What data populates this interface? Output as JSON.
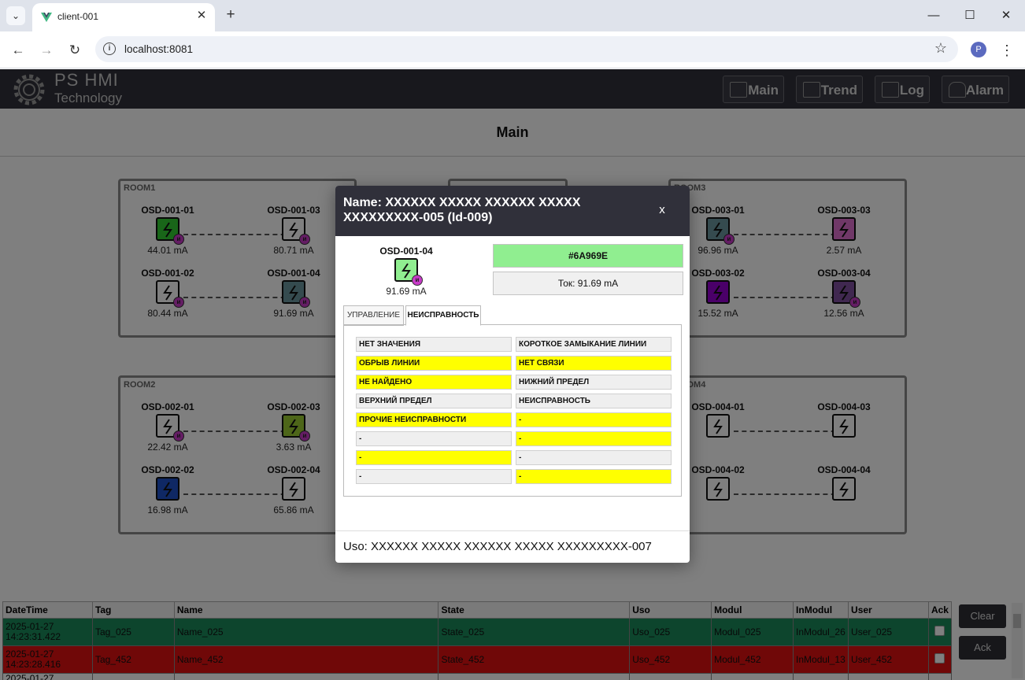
{
  "browser": {
    "tab_title": "client-001",
    "url": "localhost:8081",
    "profile_initial": "P",
    "icons": [
      "chevron-down-icon",
      "vue-logo-icon",
      "close-icon",
      "plus-icon",
      "minimize-icon",
      "maximize-icon",
      "back-icon",
      "forward-icon",
      "reload-icon",
      "info-icon",
      "star-icon",
      "kebab-menu-icon"
    ]
  },
  "app": {
    "logo_line1": "PS HMI",
    "logo_line2": "Technology",
    "nav": [
      {
        "label": "Main",
        "icon": "dashboard-icon"
      },
      {
        "label": "Trend",
        "icon": "chart-icon"
      },
      {
        "label": "Log",
        "icon": "log-icon"
      },
      {
        "label": "Alarm",
        "icon": "bell-icon"
      }
    ],
    "page_title": "Main"
  },
  "rooms": [
    {
      "label": "ROOM1",
      "devices": [
        {
          "name": "OSD-001-01",
          "value": "44.01 mA",
          "color": "#32CD32",
          "badge": true
        },
        {
          "name": "OSD-001-03",
          "value": "80.71 mA",
          "color": "#FFFFFF",
          "badge": true
        },
        {
          "name": "OSD-001-02",
          "value": "80.44 mA",
          "color": "#FFFFFF",
          "badge": true
        },
        {
          "name": "OSD-001-04",
          "value": "91.69 mA",
          "color": "#6A969E",
          "badge": true
        }
      ]
    },
    {
      "label": "ROOM2",
      "devices": [
        {
          "name": "OSD-002-01",
          "value": "22.42 mA",
          "color": "#FFFFFF",
          "badge": true
        },
        {
          "name": "OSD-002-03",
          "value": "3.63 mA",
          "color": "#9ACD32",
          "badge": true
        },
        {
          "name": "OSD-002-02",
          "value": "16.98 mA",
          "color": "#1E50C8",
          "badge": false
        },
        {
          "name": "OSD-002-04",
          "value": "65.86 mA",
          "color": "#FFFFFF",
          "badge": false
        }
      ]
    },
    {
      "label": "ROOM3",
      "devices": [
        {
          "name": "OSD-003-01",
          "value": "96.96 mA",
          "color": "#6A969E",
          "badge": true
        },
        {
          "name": "OSD-003-03",
          "value": "2.57 mA",
          "color": "#E070D0",
          "badge": false
        },
        {
          "name": "OSD-003-02",
          "value": "15.52 mA",
          "color": "#9400D3",
          "badge": false
        },
        {
          "name": "OSD-003-04",
          "value": "12.56 mA",
          "color": "#8050A0",
          "badge": true
        }
      ]
    },
    {
      "label": "ROOM4",
      "devices": [
        {
          "name": "OSD-004-01",
          "value": "",
          "color": "#FFFFFF",
          "badge": false
        },
        {
          "name": "OSD-004-03",
          "value": "",
          "color": "#FFFFFF",
          "badge": false
        },
        {
          "name": "OSD-004-02",
          "value": "",
          "color": "#FFFFFF",
          "badge": false
        },
        {
          "name": "OSD-004-04",
          "value": "",
          "color": "#FFFFFF",
          "badge": false
        }
      ]
    }
  ],
  "modal": {
    "title": "Name: XXXXXX XXXXX XXXXXX XXXXX XXXXXXXXX-005 (Id-009)",
    "close_label": "x",
    "device_name": "OSD-001-04",
    "device_value": "91.69 mA",
    "color_hex": "#6A969E",
    "current_text": "Ток: 91.69 mA",
    "tabs": [
      "УПРАВЛЕНИЕ",
      "НЕИСПРАВНОСТЬ"
    ],
    "active_tab": "НЕИСПРАВНОСТЬ",
    "faults": [
      {
        "label": "НЕТ ЗНАЧЕНИЯ",
        "active": false
      },
      {
        "label": "КОРОТКОЕ ЗАМЫКАНИЕ ЛИНИИ",
        "active": false
      },
      {
        "label": "ОБРЫВ ЛИНИИ",
        "active": true
      },
      {
        "label": "НЕТ СВЯЗИ",
        "active": true
      },
      {
        "label": "НЕ НАЙДЕНО",
        "active": true
      },
      {
        "label": "НИЖНИЙ ПРЕДЕЛ",
        "active": false
      },
      {
        "label": "ВЕРХНИЙ ПРЕДЕЛ",
        "active": false
      },
      {
        "label": "НЕИСПРАВНОСТЬ",
        "active": false
      },
      {
        "label": "ПРОЧИЕ НЕИСПРАВНОСТИ",
        "active": true
      },
      {
        "label": "-",
        "active": true
      },
      {
        "label": "-",
        "active": false
      },
      {
        "label": "-",
        "active": true
      },
      {
        "label": "-",
        "active": true
      },
      {
        "label": "-",
        "active": false
      },
      {
        "label": "-",
        "active": false
      },
      {
        "label": "-",
        "active": true
      }
    ],
    "footer": "Uso: XXXXXX XXXXX XXXXXX XXXXX XXXXXXXXX-007"
  },
  "alarms": {
    "columns": [
      "DateTime",
      "Tag",
      "Name",
      "State",
      "Uso",
      "Modul",
      "InModul",
      "User",
      "Ack"
    ],
    "rows": [
      {
        "date": "2025-01-27",
        "time": "14:23:31.422",
        "tag": "Tag_025",
        "name": "Name_025",
        "state": "State_025",
        "uso": "Uso_025",
        "modul": "Modul_025",
        "inmodul": "InModul_26",
        "user": "User_025"
      },
      {
        "date": "2025-01-27",
        "time": "14:23:28.416",
        "tag": "Tag_452",
        "name": "Name_452",
        "state": "State_452",
        "uso": "Uso_452",
        "modul": "Modul_452",
        "inmodul": "InModul_13",
        "user": "User_452"
      }
    ],
    "partial_row_date": "2025-01-27",
    "clear_label": "Clear",
    "ack_label": "Ack"
  }
}
